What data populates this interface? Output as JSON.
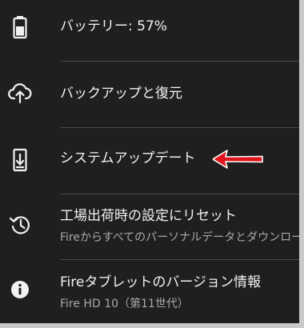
{
  "settings": {
    "items": [
      {
        "label": "バッテリー: 57%",
        "icon": "battery-icon"
      },
      {
        "label": "バックアップと復元",
        "icon": "cloud-upload-icon"
      },
      {
        "label": "システムアップデート",
        "icon": "system-update-icon"
      },
      {
        "label": "工場出荷時の設定にリセット",
        "subtitle": "Fireからすべてのパーソナルデータとダウンロード",
        "icon": "factory-reset-icon"
      },
      {
        "label": "Fireタブレットのバージョン情報",
        "subtitle": "Fire HD 10（第11世代）",
        "icon": "info-icon"
      }
    ]
  },
  "colors": {
    "background": "#1f1f1f",
    "text_primary": "#f2f2f2",
    "text_secondary": "#a9a9a9",
    "divider": "#4a4a4a",
    "annotation_arrow": "#e0141b"
  }
}
